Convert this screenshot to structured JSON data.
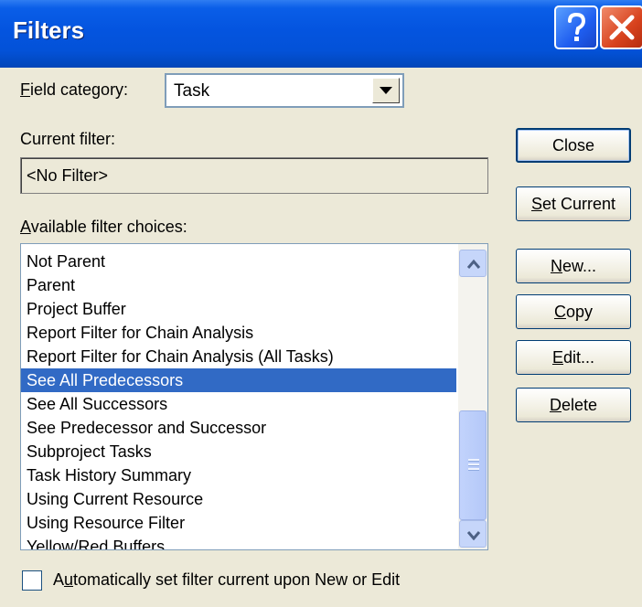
{
  "window": {
    "title": "Filters"
  },
  "field_category": {
    "label_key": "F",
    "label_rest": "ield category:",
    "value": "Task"
  },
  "current_filter": {
    "label": "Current filter:",
    "value": "<No Filter>"
  },
  "available": {
    "label_key": "A",
    "label_rest": "vailable filter choices:"
  },
  "filter_choices": [
    "Not Parent",
    "Parent",
    "Project Buffer",
    "Report Filter for Chain Analysis",
    "Report Filter for Chain Analysis (All Tasks)",
    "See All Predecessors",
    "See All Successors",
    "See Predecessor and Successor",
    "Subproject Tasks",
    "Task History Summary",
    "Using Current Resource",
    "Using Resource Filter",
    "Yellow/Red Buffers"
  ],
  "selected_choice": "See All Predecessors",
  "buttons": {
    "close": {
      "text": "Close"
    },
    "set_current": {
      "key": "S",
      "rest": "et Current"
    },
    "new": {
      "key": "N",
      "rest": "ew..."
    },
    "copy": {
      "key": "C",
      "rest": "opy"
    },
    "edit": {
      "key": "E",
      "rest": "dit..."
    },
    "delete": {
      "key": "D",
      "rest": "elete"
    }
  },
  "auto_set": {
    "pre": "A",
    "key": "u",
    "rest": "tomatically set filter current upon New or Edit",
    "checked": false
  },
  "icons": {
    "help": "help-icon",
    "close": "close-icon",
    "dropdown": "chevron-down-icon",
    "scroll_up": "chevron-up-icon",
    "scroll_down": "chevron-down-icon"
  },
  "colors": {
    "titlebar": "#0454df",
    "selection": "#316ac5",
    "dialog_bg": "#ece9d8"
  }
}
